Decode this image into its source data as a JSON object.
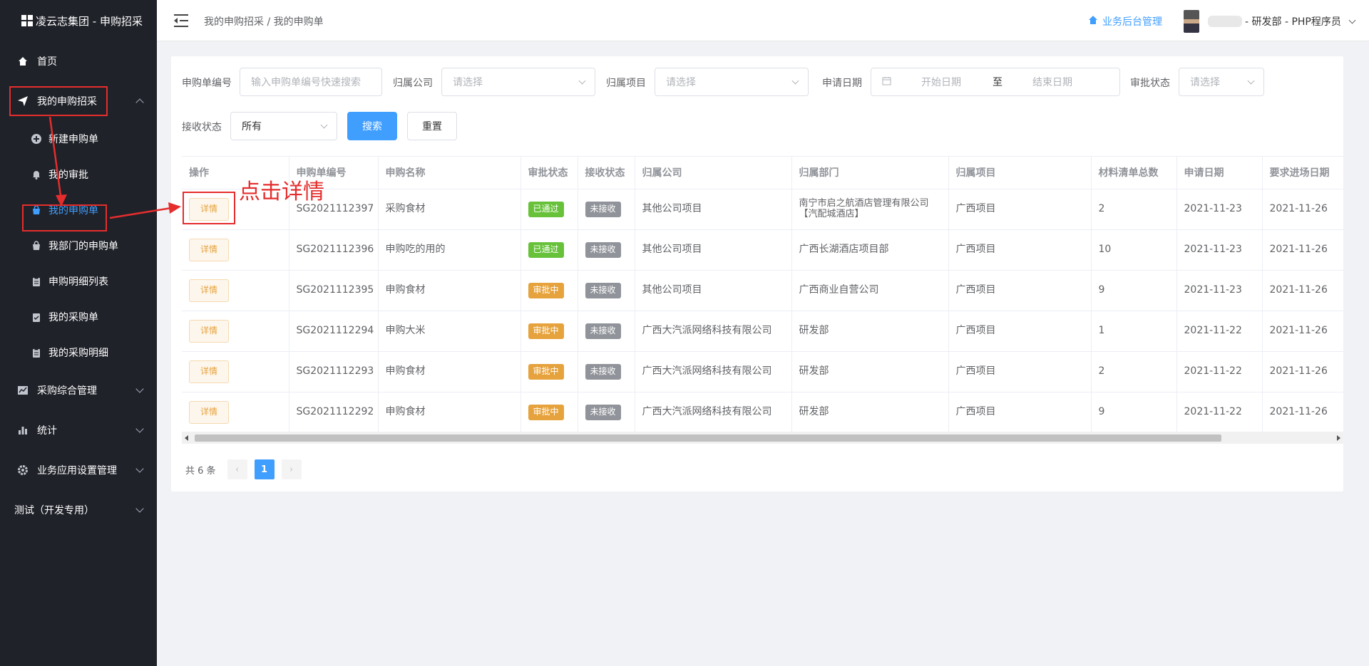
{
  "brand": {
    "title": "凌云志集团 - 申购招采"
  },
  "sidebar": {
    "home": "首页",
    "my_purchase": "我的申购招采",
    "sub_items": [
      {
        "label": "新建申购单",
        "icon": "plus-circle-icon"
      },
      {
        "label": "我的审批",
        "icon": "bell-icon"
      },
      {
        "label": "我的申购单",
        "icon": "bag-icon"
      },
      {
        "label": "我部门的申购单",
        "icon": "bag-icon"
      },
      {
        "label": "申购明细列表",
        "icon": "clipboard-icon"
      },
      {
        "label": "我的采购单",
        "icon": "clipboard-check-icon"
      },
      {
        "label": "我的采购明细",
        "icon": "clipboard-icon"
      }
    ],
    "procurement": "采购综合管理",
    "stats": "统计",
    "settings": "业务应用设置管理",
    "test": "测试（开发专用）"
  },
  "header": {
    "breadcrumb": "我的申购招采 / 我的申购单",
    "backend_link": "业务后台管理",
    "user_info": "- 研发部 - PHP程序员"
  },
  "filters": {
    "order_no_label": "申购单编号",
    "order_no_placeholder": "输入申购单编号快速搜索",
    "company_label": "归属公司",
    "company_placeholder": "请选择",
    "project_label": "归属项目",
    "project_placeholder": "请选择",
    "date_label": "申请日期",
    "date_start": "开始日期",
    "date_sep": "至",
    "date_end": "结束日期",
    "approval_label": "审批状态",
    "approval_placeholder": "请选择",
    "receive_label": "接收状态",
    "receive_value": "所有",
    "search_btn": "搜索",
    "reset_btn": "重置"
  },
  "table": {
    "headers": [
      "操作",
      "申购单编号",
      "申购名称",
      "审批状态",
      "接收状态",
      "归属公司",
      "归属部门",
      "归属项目",
      "材料清单总数",
      "申请日期",
      "要求进场日期"
    ],
    "detail_label": "详情",
    "rows": [
      {
        "no": "SG2021112397",
        "name": "采购食材",
        "approval": "已通过",
        "receive": "未接收",
        "company": "其他公司项目",
        "dept": "南宁市启之航酒店管理有限公司【汽配城酒店】",
        "project": "广西项目",
        "count": "2",
        "date": "2021-11-23",
        "due": "2021-11-26"
      },
      {
        "no": "SG2021112396",
        "name": "申购吃的用的",
        "approval": "已通过",
        "receive": "未接收",
        "company": "其他公司项目",
        "dept": "广西长湖酒店项目部",
        "project": "广西项目",
        "count": "10",
        "date": "2021-11-23",
        "due": "2021-11-26"
      },
      {
        "no": "SG2021112395",
        "name": "申购食材",
        "approval": "审批中",
        "receive": "未接收",
        "company": "其他公司项目",
        "dept": "广西商业自营公司",
        "project": "广西项目",
        "count": "9",
        "date": "2021-11-23",
        "due": "2021-11-26"
      },
      {
        "no": "SG2021112294",
        "name": "申购大米",
        "approval": "审批中",
        "receive": "未接收",
        "company": "广西大汽派网络科技有限公司",
        "dept": "研发部",
        "project": "广西项目",
        "count": "1",
        "date": "2021-11-22",
        "due": "2021-11-26"
      },
      {
        "no": "SG2021112293",
        "name": "申购食材",
        "approval": "审批中",
        "receive": "未接收",
        "company": "广西大汽派网络科技有限公司",
        "dept": "研发部",
        "project": "广西项目",
        "count": "2",
        "date": "2021-11-22",
        "due": "2021-11-26"
      },
      {
        "no": "SG2021112292",
        "name": "申购食材",
        "approval": "审批中",
        "receive": "未接收",
        "company": "广西大汽派网络科技有限公司",
        "dept": "研发部",
        "project": "广西项目",
        "count": "9",
        "date": "2021-11-22",
        "due": "2021-11-26"
      }
    ]
  },
  "pagination": {
    "total": "共 6 条",
    "current": "1"
  },
  "annotation": {
    "callout": "点击详情"
  },
  "colors": {
    "primary": "#409eff",
    "sidebar": "#1f2229",
    "annotation": "#e52d2d",
    "success": "#67c23a",
    "warning": "#e6a23c"
  }
}
